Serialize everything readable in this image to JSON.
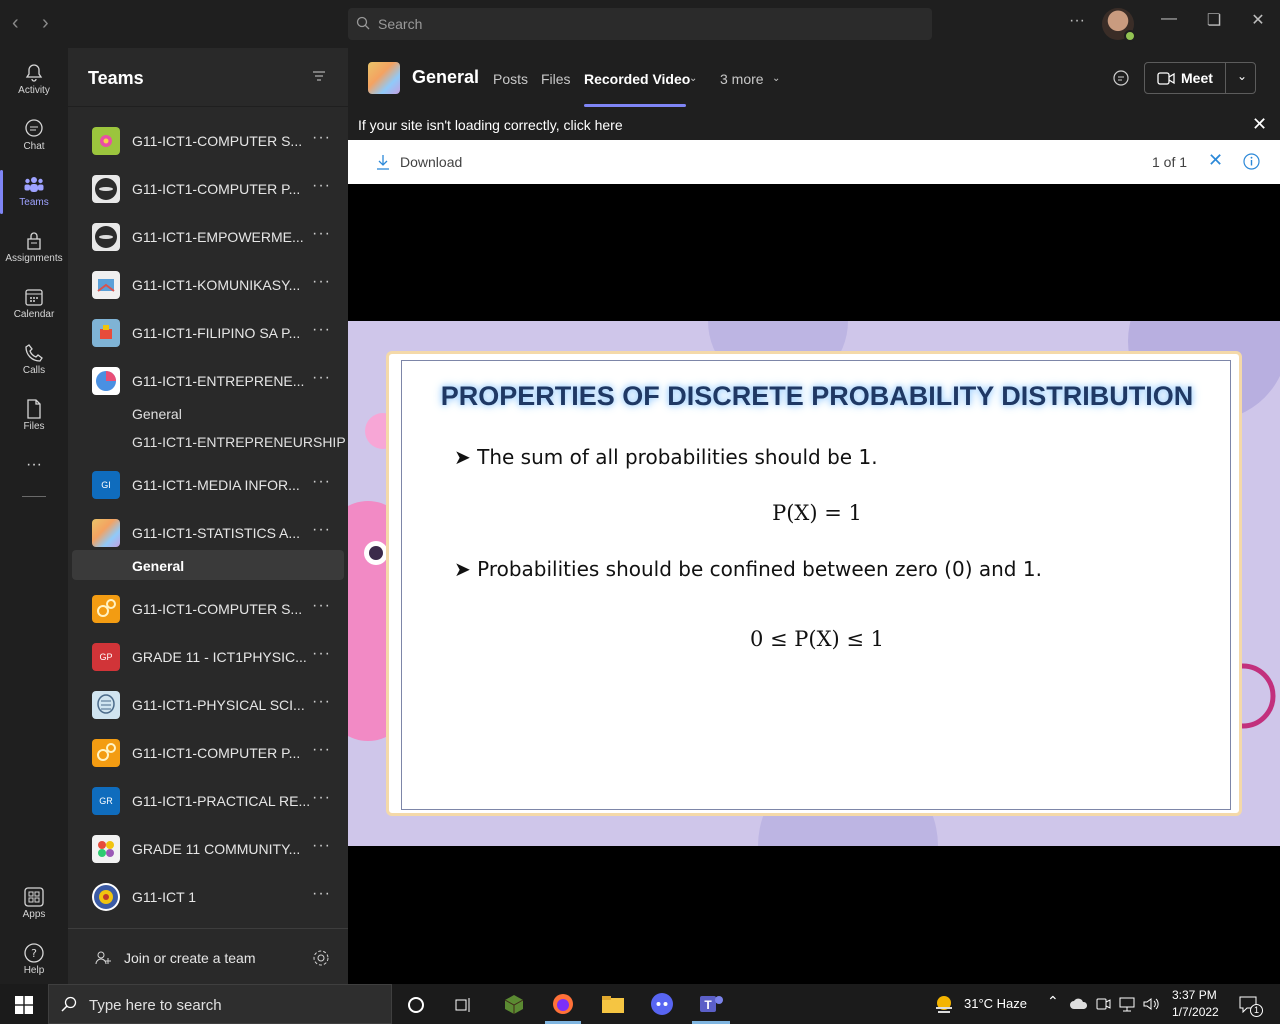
{
  "titlebar": {
    "search_placeholder": "Search",
    "more": "···"
  },
  "rail": [
    {
      "label": "Activity",
      "icon": "bell-icon"
    },
    {
      "label": "Chat",
      "icon": "chat-icon"
    },
    {
      "label": "Teams",
      "icon": "teams-icon",
      "active": true
    },
    {
      "label": "Assignments",
      "icon": "assignments-icon"
    },
    {
      "label": "Calendar",
      "icon": "calendar-icon"
    },
    {
      "label": "Calls",
      "icon": "phone-icon"
    },
    {
      "label": "Files",
      "icon": "file-icon"
    },
    {
      "label": "···",
      "icon": "more-icon"
    },
    {
      "label": "Apps",
      "icon": "apps-icon"
    },
    {
      "label": "Help",
      "icon": "help-icon"
    }
  ],
  "panel": {
    "title": "Teams",
    "teams": [
      {
        "name": "G11-ICT1-COMPUTER S...",
        "avatar_color": "#9bc53d"
      },
      {
        "name": "G11-ICT1-COMPUTER P...",
        "avatar_color": "#e8e8e8"
      },
      {
        "name": "G11-ICT1-EMPOWERME...",
        "avatar_color": "#e8e8e8"
      },
      {
        "name": "G11-ICT1-KOMUNIKASY...",
        "avatar_color": "#f0f0f0"
      },
      {
        "name": "G11-ICT1-FILIPINO SA P...",
        "avatar_color": "#7fb3d5"
      },
      {
        "name": "G11-ICT1-ENTREPRENE...",
        "avatar_color": "#ffffff"
      },
      {
        "name": "G11-ICT1-MEDIA INFOR...",
        "avatar_color": "#0f6cbd",
        "initials": "GI"
      },
      {
        "name": "G11-ICT1-STATISTICS A...",
        "avatar_color": "#e9c46a"
      },
      {
        "name": "G11-ICT1-COMPUTER S...",
        "avatar_color": "#f39c12"
      },
      {
        "name": "GRADE 11 - ICT1PHYSIC...",
        "avatar_color": "#d13438",
        "initials": "GP"
      },
      {
        "name": "G11-ICT1-PHYSICAL SCI...",
        "avatar_color": "#d0e4f0"
      },
      {
        "name": "G11-ICT1-COMPUTER P...",
        "avatar_color": "#f39c12"
      },
      {
        "name": "G11-ICT1-PRACTICAL RE...",
        "avatar_color": "#0f6cbd",
        "initials": "GR"
      },
      {
        "name": "GRADE 11 COMMUNITY...",
        "avatar_color": "#f2f2f2"
      },
      {
        "name": "G11-ICT 1",
        "avatar_color": "#3b5ba5"
      }
    ],
    "entre_channels": [
      "General",
      "G11-ICT1-ENTREPRENEURSHIP"
    ],
    "stats_channel": "General",
    "join_label": "Join or create a team"
  },
  "header": {
    "channel_name": "General",
    "tabs": [
      "Posts",
      "Files",
      "Recorded Video",
      "3 more"
    ],
    "active_tab": "Recorded Video",
    "meet_label": "Meet"
  },
  "banner": {
    "text": "If your site isn't loading correctly, click here"
  },
  "viewer": {
    "download_label": "Download",
    "page_indicator": "1 of 1"
  },
  "slide": {
    "title": "PROPERTIES OF DISCRETE PROBABILITY DISTRIBUTION",
    "bullet1": "The sum of all probabilities should be 1.",
    "formula1": "P(X) = 1",
    "bullet2": "Probabilities should be confined between zero (0) and 1.",
    "formula2": "0 ≤ P(X) ≤ 1"
  },
  "taskbar": {
    "search_placeholder": "Type here to search",
    "weather": "31°C  Haze",
    "time": "3:37 PM",
    "date": "1/7/2022",
    "notification_count": "1"
  },
  "colors": {
    "accent": "#7f85f5",
    "panel_bg": "#292929",
    "app_bg": "#1f1f1f"
  }
}
